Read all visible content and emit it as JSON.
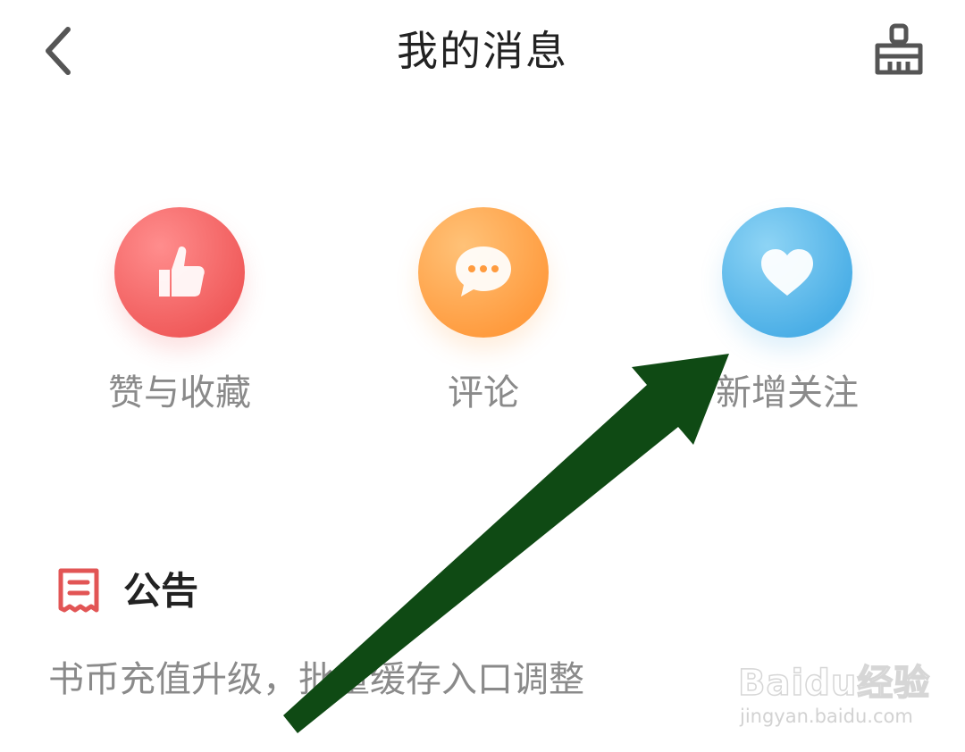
{
  "header": {
    "title": "我的消息",
    "back_icon": "chevron-left-icon",
    "clear_icon": "broom-icon"
  },
  "categories": [
    {
      "label": "赞与收藏",
      "icon": "thumbs-up-icon",
      "color": "#f05a5a"
    },
    {
      "label": "评论",
      "icon": "chat-bubble-icon",
      "color": "#ff9b3e"
    },
    {
      "label": "新增关注",
      "icon": "heart-icon",
      "color": "#4aaee6"
    }
  ],
  "notice": {
    "title": "公告",
    "icon": "receipt-icon",
    "icon_color": "#e25555",
    "text": "书币充值升级，批量缓存入口调整"
  },
  "annotation": {
    "arrow_color": "#0f4a14"
  },
  "watermark": {
    "logo": "Baidu经验",
    "url": "jingyan.baidu.com"
  }
}
